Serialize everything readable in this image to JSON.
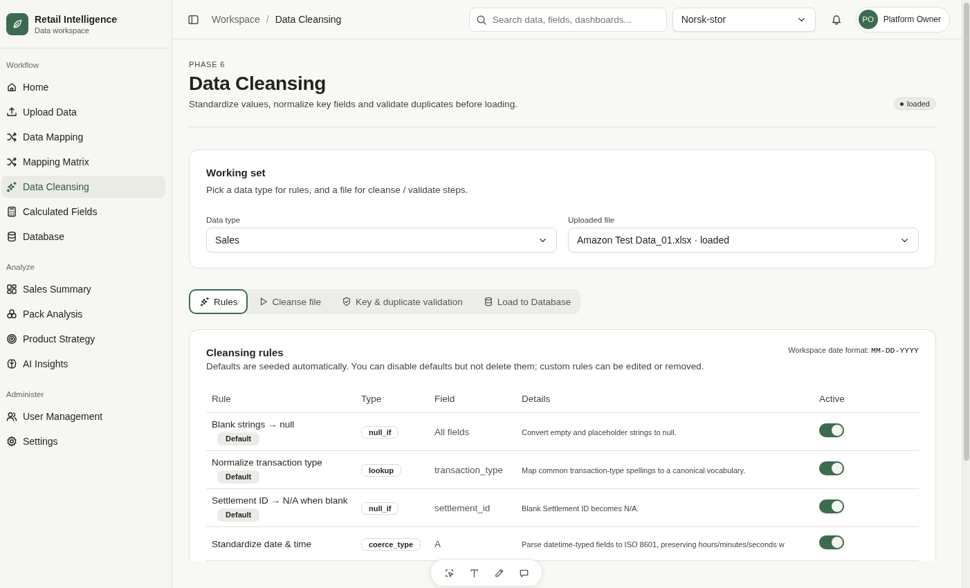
{
  "brand": {
    "name": "Retail Intelligence",
    "subtitle": "Data workspace"
  },
  "sidebar": {
    "sections": [
      {
        "title": "Workflow",
        "items": [
          {
            "label": "Home",
            "selected": false
          },
          {
            "label": "Upload Data",
            "selected": false
          },
          {
            "label": "Data Mapping",
            "selected": false
          },
          {
            "label": "Mapping Matrix",
            "selected": false
          },
          {
            "label": "Data Cleansing",
            "selected": true
          },
          {
            "label": "Calculated Fields",
            "selected": false
          },
          {
            "label": "Database",
            "selected": false
          }
        ]
      },
      {
        "title": "Analyze",
        "items": [
          {
            "label": "Sales Summary",
            "selected": false
          },
          {
            "label": "Pack Analysis",
            "selected": false
          },
          {
            "label": "Product Strategy",
            "selected": false
          },
          {
            "label": "AI Insights",
            "selected": false
          }
        ]
      },
      {
        "title": "Administer",
        "items": [
          {
            "label": "User Management",
            "selected": false
          },
          {
            "label": "Settings",
            "selected": false
          }
        ]
      }
    ]
  },
  "topbar": {
    "breadcrumb": [
      "Workspace",
      "Data Cleansing"
    ],
    "breadcrumb_separator": "/",
    "search": {
      "placeholder": "Search data, fields, dashboards..."
    },
    "store_select": {
      "value": "Norsk-stor"
    },
    "user": {
      "initials": "PO",
      "name": "Platform Owner"
    }
  },
  "page": {
    "eyebrow": "PHASE 6",
    "title": "Data Cleansing",
    "subtitle": "Standardize values, normalize key fields and validate duplicates before loading.",
    "status": "loaded"
  },
  "working_set": {
    "title": "Working set",
    "description": "Pick a data type for rules, and a file for cleanse / validate steps.",
    "fields": [
      {
        "label": "Data type",
        "value": "Sales"
      },
      {
        "label": "Uploaded file",
        "value": "Amazon Test Data_01.xlsx · loaded"
      }
    ]
  },
  "tabs": [
    {
      "label": "Rules",
      "selected": true
    },
    {
      "label": "Cleanse file",
      "selected": false
    },
    {
      "label": "Key & duplicate validation",
      "selected": false
    },
    {
      "label": "Load to Database",
      "selected": false
    }
  ],
  "rules": {
    "title": "Cleansing rules",
    "description": "Defaults are seeded automatically. You can disable defaults but not delete them; custom rules can be edited or removed.",
    "date_format_label": "Workspace date format:",
    "date_format": "MM-DD-YYYY",
    "columns": [
      "Rule",
      "Type",
      "Field",
      "Details",
      "Active"
    ],
    "rows": [
      {
        "rule": "Blank strings → null",
        "badge": "Default",
        "type": "null_if",
        "field": "All fields",
        "details": "Convert empty and placeholder strings to null.",
        "active": true
      },
      {
        "rule": "Normalize transaction type",
        "badge": "Default",
        "type": "lookup",
        "field": "transaction_type",
        "details": "Map common transaction-type spellings to a canonical vocabulary.",
        "active": true
      },
      {
        "rule": "Settlement ID → N/A when blank",
        "badge": "Default",
        "type": "null_if",
        "field": "settlement_id",
        "details": "Blank Settlement ID becomes N/A.",
        "active": true
      },
      {
        "rule": "Standardize date & time",
        "type": "coerce_type",
        "field": "A",
        "details": "Parse datetime-typed fields to ISO 8601, preserving hours/minutes/seconds w",
        "active": true
      }
    ]
  }
}
